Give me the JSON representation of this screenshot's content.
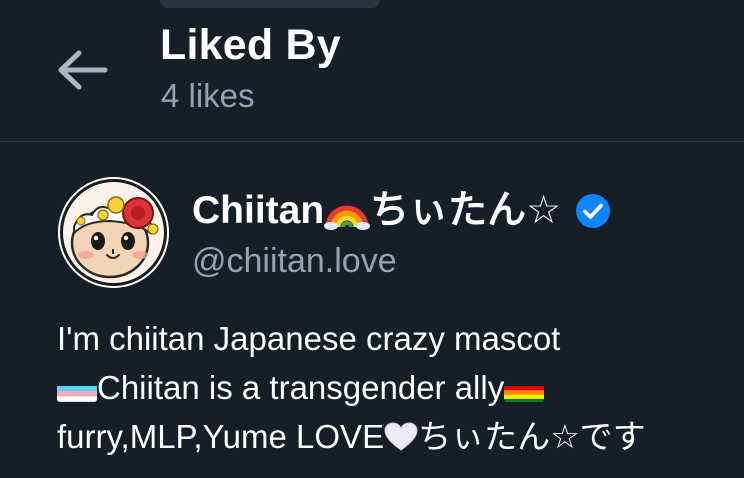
{
  "header": {
    "back_icon": "arrow-left-icon",
    "title": "Liked By",
    "subtitle": "4 likes"
  },
  "user": {
    "avatar_icon": "chiitan-mascot-avatar",
    "name_before": "Chiitan",
    "name_emoji": "rainbow-emoji",
    "name_after": "ちぃたん☆",
    "verified_icon": "verified-check-icon",
    "handle": "@chiitan.love",
    "bio_line1": "I'm chiitan Japanese crazy mascot",
    "bio_line2_flag": "transgender-flag-emoji",
    "bio_line2_text": "Chiitan is a transgender ally",
    "bio_line2_flag_end": "rainbow-flag-emoji",
    "bio_line3_text": "furry,MLP,Yume LOVE",
    "bio_line3_heart": "white-heart-emoji",
    "bio_line3_tail": "ちぃたん☆です"
  },
  "colors": {
    "background": "#161e27",
    "secondary_text": "#93a3b3",
    "verified_blue": "#1185fe",
    "divider": "#2a3540"
  }
}
